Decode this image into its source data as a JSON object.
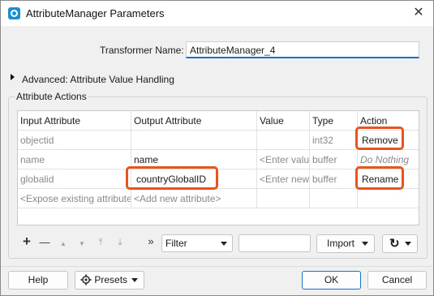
{
  "window": {
    "title": "AttributeManager Parameters",
    "close_glyph": "✕"
  },
  "transformer": {
    "label": "Transformer Name:",
    "value": "AttributeManager_4"
  },
  "advanced": {
    "label": "Advanced: Attribute Value Handling"
  },
  "attribute_actions": {
    "label": "Attribute Actions",
    "columns": [
      "Input Attribute",
      "Output Attribute",
      "Value",
      "Type",
      "Action"
    ],
    "rows": [
      {
        "input": "objectid",
        "output": "",
        "value": "",
        "type": "int32",
        "action": "Remove"
      },
      {
        "input": "name",
        "output": "name",
        "value": "<Enter value>",
        "type": "buffer",
        "action": "Do Nothing"
      },
      {
        "input": "globalid",
        "output": "countryGlobalID",
        "value": "<Enter new value>",
        "type": "buffer",
        "action": "Rename"
      },
      {
        "input": "<Expose existing attribute>",
        "output": "<Add new attribute>",
        "value": "",
        "type": "",
        "action": ""
      }
    ],
    "highlight_color": "#e8541e"
  },
  "toolbar": {
    "add_glyph": "+",
    "remove_glyph": "—",
    "move_up_glyph": "▲",
    "move_down_glyph": "▼",
    "move_top_glyph": "⤒",
    "move_bottom_glyph": "⤓",
    "expand_glyph": "»",
    "filter_label": "Filter",
    "filter_text": "",
    "import_label": "Import",
    "refresh_glyph": "↻"
  },
  "footer": {
    "help": "Help",
    "presets": "Presets",
    "ok": "OK",
    "cancel": "Cancel"
  },
  "icons": [
    "app-icon",
    "close-icon",
    "expand-triangle-icon",
    "add-icon",
    "remove-icon",
    "move-up-icon",
    "move-down-icon",
    "move-top-icon",
    "move-bottom-icon",
    "chevron-right-double-icon",
    "refresh-icon",
    "gear-icon"
  ]
}
